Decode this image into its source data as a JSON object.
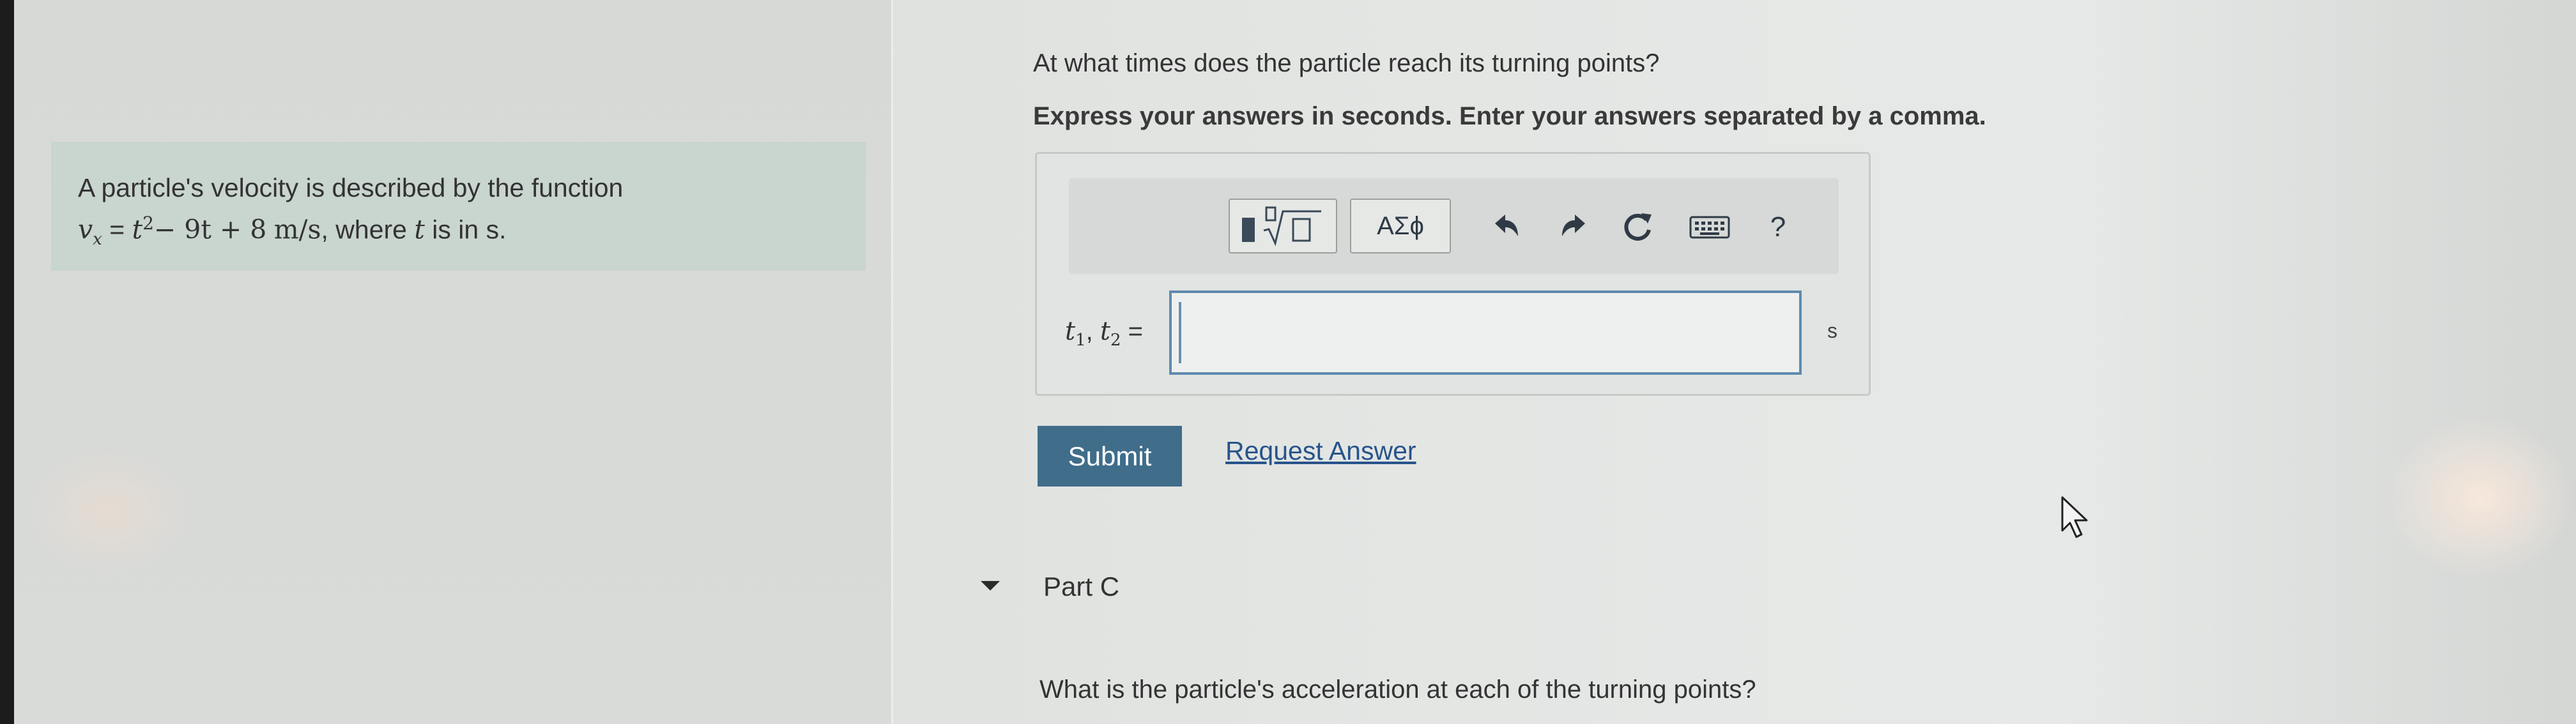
{
  "problem": {
    "intro": "A particle's velocity is described by the function",
    "equation": {
      "lhs": "v",
      "lhs_sub": "x",
      "eq": "=",
      "t": "t",
      "t_exp": "2",
      "minus_term": "− 9t + 8",
      "unit": "m/s",
      "where": ", where",
      "where_var": "t",
      "where_rest": "is in s."
    }
  },
  "question": {
    "prompt": "At what times does the particle reach its turning points?",
    "instruction": "Express your answers in seconds. Enter your answers separated by a comma."
  },
  "toolbar": {
    "template_icon": "radical-template-icon",
    "greek_label": "ΑΣϕ",
    "undo_icon": "undo-icon",
    "redo_icon": "redo-icon",
    "reset_icon": "reset-icon",
    "keyboard_icon": "keyboard-icon",
    "help_label": "?"
  },
  "answer": {
    "label_t1": "t",
    "label_t1_sub": "1",
    "label_sep": ", ",
    "label_t2": "t",
    "label_t2_sub": "2",
    "label_eq": " =",
    "value": "",
    "unit": "s"
  },
  "actions": {
    "submit_label": "Submit",
    "request_label": "Request Answer"
  },
  "part_c": {
    "title": "Part C",
    "question": "What is the particle's acceleration at each of the turning points?"
  },
  "colors": {
    "submit_bg": "#3f6d8a",
    "link": "#27548a",
    "problem_bg": "#c9d5cf",
    "input_border": "#5f8ab0"
  }
}
